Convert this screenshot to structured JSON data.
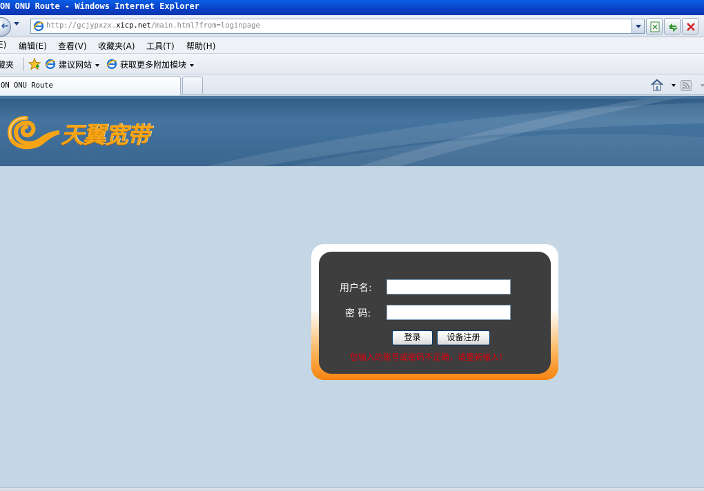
{
  "window": {
    "title": "ON ONU Route - Windows Internet Explorer"
  },
  "address_bar": {
    "url_prefix": "http://gcjypxzx.",
    "url_domain": "xicp.net",
    "url_suffix": "/main.html?from=loginpage"
  },
  "menu": {
    "items": [
      "E)",
      "编辑(E)",
      "查看(V)",
      "收藏夹(A)",
      "工具(T)",
      "帮助(H)"
    ]
  },
  "favorites": {
    "label": "藏夹",
    "items": [
      "建议网站",
      "获取更多附加模块"
    ]
  },
  "tab": {
    "title": "ON ONU Route"
  },
  "banner": {
    "brand": "天翼宽带",
    "colors": {
      "background": "#3a668f",
      "logo": "#f7a516"
    }
  },
  "login": {
    "username_label": "用户名:",
    "password_label": "密  码:",
    "username_value": "",
    "password_value": "",
    "login_button": "登录",
    "register_button": "设备注册",
    "error_message": "您输入的账号或密码不正确，请重新输入！"
  },
  "colors": {
    "page_background": "#c5d7e4",
    "panel_background": "#3e3e3e",
    "frame_accent": "#f5820f",
    "error_text": "#e0000f"
  }
}
